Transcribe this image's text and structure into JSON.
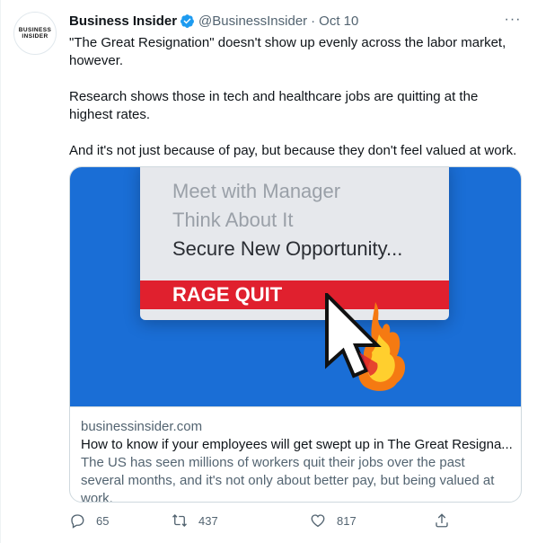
{
  "tweet": {
    "author_name": "Business Insider",
    "avatar_text": [
      "BUSINESS",
      "INSIDER"
    ],
    "handle": "@BusinessInsider",
    "separator": "·",
    "date": "Oct 10",
    "more": "···",
    "paragraphs": [
      "\"The Great Resignation\" doesn't show up evenly across the labor market, however.",
      "Research shows those in tech and healthcare jobs are quitting at the highest rates.",
      "And it's not just because of pay, but because they don't feel valued at work."
    ]
  },
  "card": {
    "image_menu": {
      "item1": "Meet with Manager",
      "item2": "Think About It",
      "item3": "Secure New Opportunity...",
      "highlight": "RAGE QUIT"
    },
    "domain": "businessinsider.com",
    "title": "How to know if your employees will get swept up in The Great Resigna...",
    "description": "The US has seen millions of workers quit their jobs over the past several months, and it's not only about better pay, but being valued at work."
  },
  "actions": {
    "replies": "65",
    "retweets": "437",
    "likes": "817"
  },
  "colors": {
    "verified": "#1d9bf0",
    "image_bg": "#1a6ed6",
    "rage_red": "#e0202e",
    "secondary_text": "#536471"
  },
  "icons": [
    "verified-badge-icon",
    "more-icon",
    "reply-icon",
    "retweet-icon",
    "like-icon",
    "share-icon",
    "fire-cursor-icon"
  ]
}
